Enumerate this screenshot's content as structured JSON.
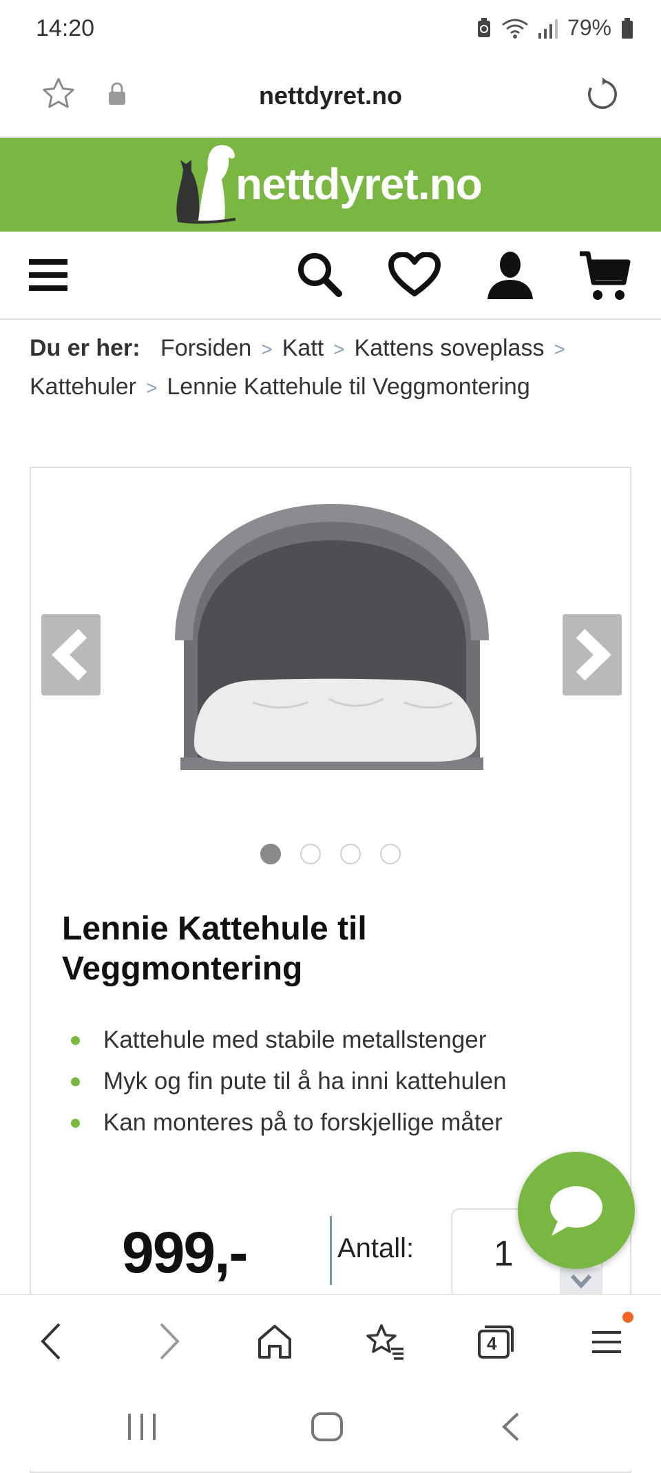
{
  "status_bar": {
    "time": "14:20",
    "battery": "79%"
  },
  "browser": {
    "url": "nettdyret.no",
    "tab_count": "4"
  },
  "site": {
    "logo_text": "nettdyret.no"
  },
  "breadcrumb": {
    "lead": "Du er her:",
    "items": [
      "Forsiden",
      "Katt",
      "Kattens soveplass",
      "Kattehuler",
      "Lennie Kattehule til Veggmontering"
    ]
  },
  "product": {
    "title": "Lennie Kattehule til Veggmontering",
    "features": [
      "Kattehule med stabile metallstenger",
      "Myk og fin pute til å ha inni kattehulen",
      "Kan monteres på to forskjellige måter"
    ],
    "price": "999,-",
    "quantity_label": "Antall:",
    "quantity": "1",
    "image_count": 4,
    "active_image": 1
  },
  "colors": {
    "brand_green": "#7ab642",
    "notification": "#f26522"
  },
  "icons": [
    "star-icon",
    "lock-icon",
    "reload-icon",
    "menu-icon",
    "search-icon",
    "heart-icon",
    "user-icon",
    "cart-icon",
    "chat-icon",
    "back-icon",
    "forward-icon",
    "home-icon",
    "bookmarks-icon",
    "tabs-icon",
    "browser-menu-icon"
  ]
}
